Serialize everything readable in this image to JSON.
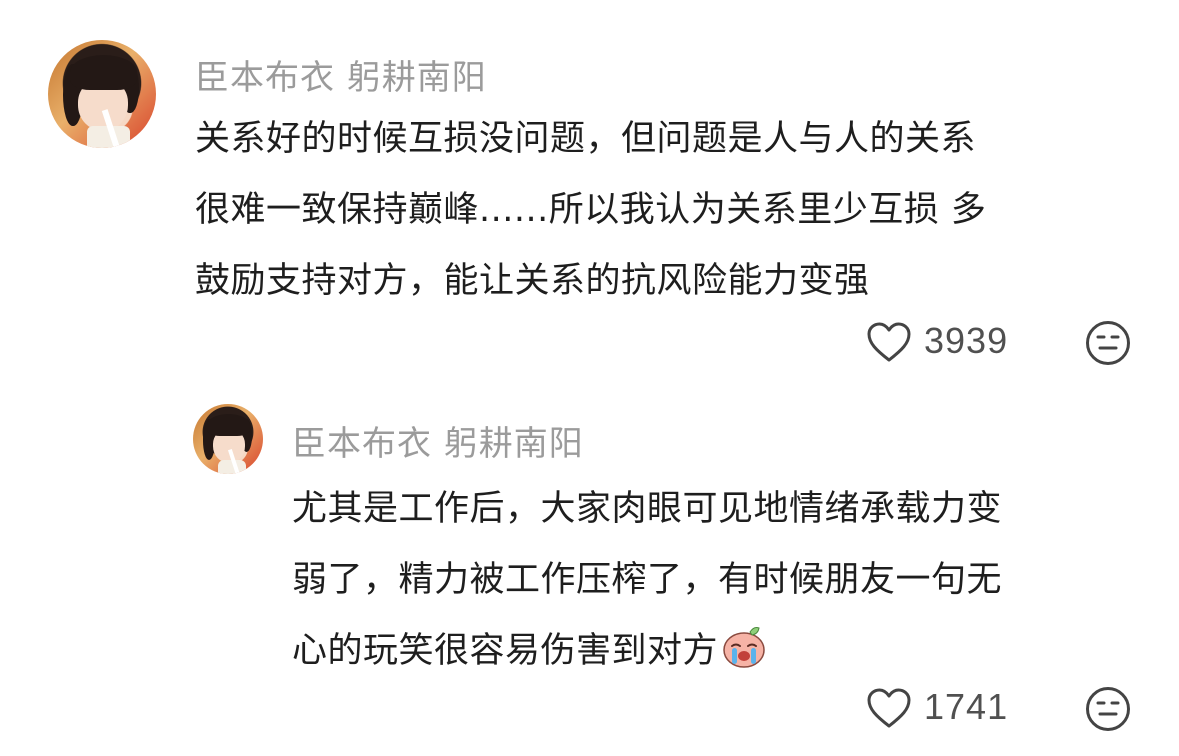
{
  "comments": [
    {
      "username": "臣本布衣 躬耕南阳",
      "lines": [
        "关系好的时候互损没问题，但问题是人与人的关系",
        "很难一致保持巅峰......所以我认为关系里少互损 多",
        "鼓励支持对方，能让关系的抗风险能力变强"
      ],
      "likes": "3939",
      "icons": {
        "like": "heart-outline-icon",
        "react": "neutral-face-icon",
        "avatar": "girl-avatar"
      }
    },
    {
      "username": "臣本布衣 躬耕南阳",
      "lines": [
        "尤其是工作后，大家肉眼可见地情绪承载力变",
        "弱了，精力被工作压榨了，有时候朋友一句无",
        "心的玩笑很容易伤害到对方"
      ],
      "emoji": "crying-face-emoji",
      "likes": "1741",
      "icons": {
        "like": "heart-outline-icon",
        "react": "neutral-face-icon",
        "avatar": "girl-avatar"
      }
    }
  ],
  "colors": {
    "username": "#9b9b9b",
    "text": "#1e1e1e",
    "meta": "#505050",
    "background": "#ffffff"
  }
}
